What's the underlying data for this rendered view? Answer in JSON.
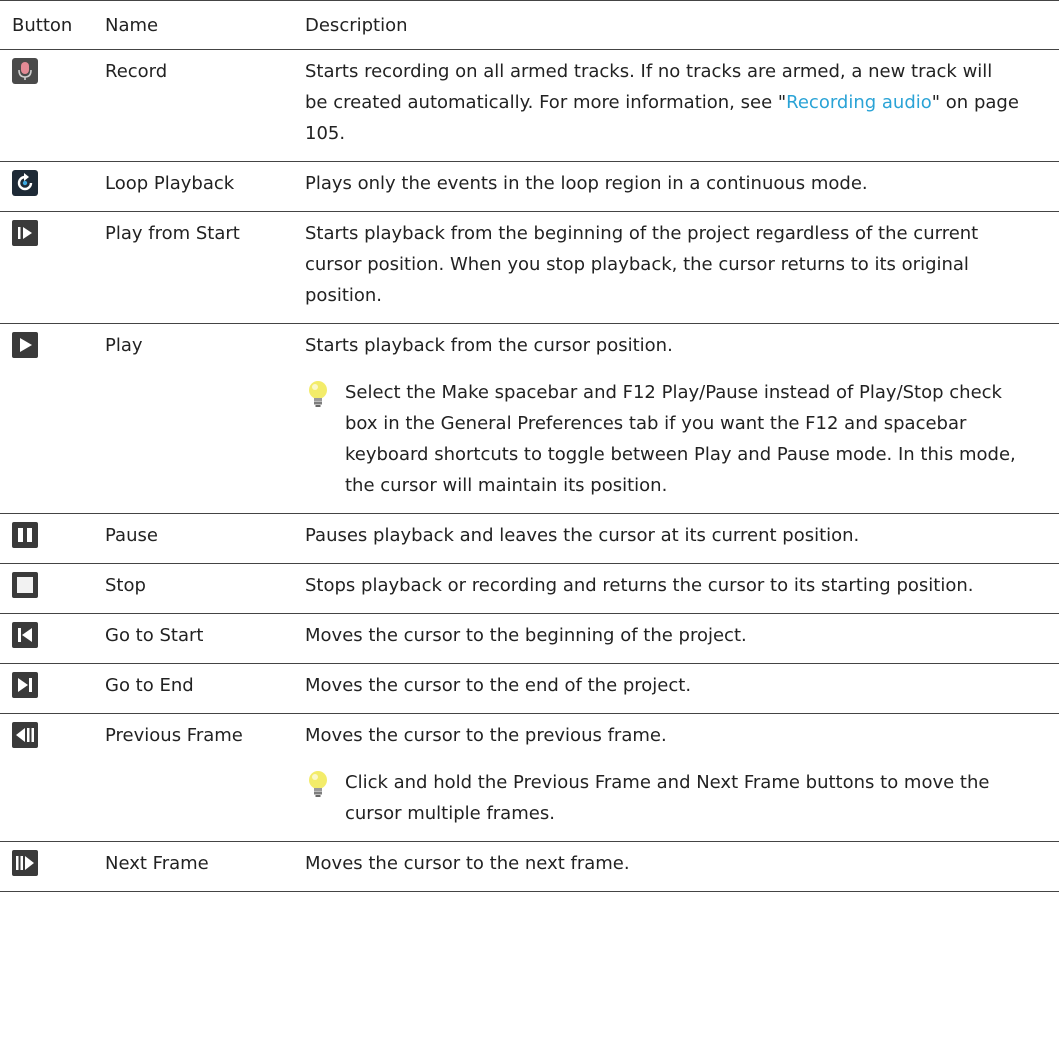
{
  "header": {
    "button": "Button",
    "name": "Name",
    "description": "Description"
  },
  "rows": [
    {
      "icon": "record-icon",
      "name": "Record",
      "desc_pre": "Starts recording on all armed tracks. If no tracks are armed, a new track will be created automatically. For more information, see \"",
      "desc_link": "Recording audio",
      "desc_post": "\" on page 105."
    },
    {
      "icon": "loop-playback-icon",
      "name": "Loop Playback",
      "desc": "Plays only the events in the loop region in a continuous mode."
    },
    {
      "icon": "play-from-start-icon",
      "name": "Play from Start",
      "desc": "Starts playback from the beginning of the project regardless of the current cursor position. When you stop playback, the cursor returns to its original position."
    },
    {
      "icon": "play-icon",
      "name": "Play",
      "desc": "Starts playback from the cursor position.",
      "tip": "Select the Make spacebar and F12 Play/Pause instead of Play/Stop check box in the General Preferences tab if you want the F12 and spacebar keyboard shortcuts to toggle between Play and Pause mode. In this mode, the cursor will maintain its position."
    },
    {
      "icon": "pause-icon",
      "name": "Pause",
      "desc": "Pauses playback and leaves the cursor at its current position."
    },
    {
      "icon": "stop-icon",
      "name": "Stop",
      "desc": "Stops playback or recording and returns the cursor to its starting position."
    },
    {
      "icon": "go-to-start-icon",
      "name": "Go to Start",
      "desc": "Moves the cursor to the beginning of the project."
    },
    {
      "icon": "go-to-end-icon",
      "name": "Go to End",
      "desc": "Moves the cursor to the end of the project."
    },
    {
      "icon": "previous-frame-icon",
      "name": "Previous Frame",
      "desc": "Moves the cursor to the previous frame.",
      "tip": "Click and hold the Previous Frame and Next Frame buttons to move the cursor multiple frames."
    },
    {
      "icon": "next-frame-icon",
      "name": "Next Frame",
      "desc": "Moves the cursor to the next frame."
    }
  ],
  "colors": {
    "link": "#2aa3d6",
    "rule": "#444444",
    "icon_bg": "#3a3a3a"
  }
}
